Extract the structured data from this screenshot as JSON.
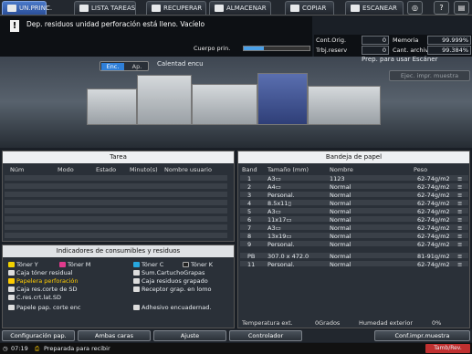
{
  "tabs": [
    "UN.PRINC.",
    "LISTA TAREAS",
    "RECUPERAR",
    "ALMACENAR",
    "COPIAR",
    "ESCANEAR"
  ],
  "message": {
    "text": "Dep. residuos unidad perforación está lleno. Vacíelo",
    "cuerpo_label": "Cuerpo prin.",
    "cuerpo_level": 0.3
  },
  "counters": {
    "cont_orig_label": "Cont.Orig.",
    "cont_orig": "0",
    "memoria_label": "Memoria",
    "memoria": "99.999%",
    "trbj_label": "Trbj.reserv",
    "trbj": "0",
    "cant_label": "Cant. archiv.",
    "cant": "99.384%"
  },
  "mode": {
    "enc": "Enc.",
    "ap": "Ap.",
    "calent": "Calentad encu"
  },
  "scanner": {
    "prep": "Prep. para usar Escáner",
    "ejec": "Ejec. impr. muestra"
  },
  "tarea": {
    "title": "Tarea",
    "headers": [
      "Núm",
      "Modo",
      "Estado",
      "Minuto(s)",
      "Nombre usuario"
    ]
  },
  "bandeja": {
    "title": "Bandeja de papel",
    "headers": [
      "Band",
      "Tamaño (mm)",
      "Nombre",
      "Peso"
    ],
    "rows": [
      {
        "b": "1",
        "t": "A3▭",
        "n": "1123",
        "p": "62-74g/m2"
      },
      {
        "b": "2",
        "t": "A4▭",
        "n": "Normal",
        "p": "62-74g/m2"
      },
      {
        "b": "3",
        "t": "Personal.",
        "n": "Normal",
        "p": "62-74g/m2"
      },
      {
        "b": "4",
        "t": "8.5x11▯",
        "n": "Normal",
        "p": "62-74g/m2"
      },
      {
        "b": "5",
        "t": "A3▭",
        "n": "Normal",
        "p": "62-74g/m2"
      },
      {
        "b": "6",
        "t": "11x17▭",
        "n": "Normal",
        "p": "62-74g/m2"
      },
      {
        "b": "7",
        "t": "A3▭",
        "n": "Normal",
        "p": "62-74g/m2"
      },
      {
        "b": "8",
        "t": "13x19▭",
        "n": "Normal",
        "p": "62-74g/m2"
      },
      {
        "b": "9",
        "t": "Personal.",
        "n": "Normal",
        "p": "62-74g/m2"
      },
      {
        "b": "PB",
        "t": "307.0 x 472.0",
        "n": "Normal",
        "p": "81-91g/m2"
      },
      {
        "b": "11",
        "t": "Personal.",
        "n": "Normal",
        "p": "62-74g/m2"
      }
    ],
    "temp_label": "Temperatura ext.",
    "temp": "0Grados",
    "hum_label": "Humedad exterior",
    "hum": "0%"
  },
  "consumibles": {
    "title": "Indicadores de consumibles y residuos",
    "items": [
      "Tóner Y",
      "Tóner M",
      "Tóner C",
      "Tóner K",
      "Caja tóner residual",
      "Sum.CartuchoGrapas",
      "Papelera perforación",
      "Caja residuos grapado",
      "Caja res.corte de SD",
      "Receptor grap. en lomo",
      "C.res.crt.lat.SD",
      "Papele pap. corte enc",
      "Adhesivo encuadernad."
    ]
  },
  "buttons": [
    "Configuración pap.",
    "Ambas caras",
    "Ajuste",
    "Controlador",
    "Conf.impr.muestra"
  ],
  "status": {
    "time": "07:19",
    "text": "Preparada para recibir",
    "tamb": "Tamb/Rev."
  },
  "colors": {
    "accent": "#3d6ab8",
    "warning": "#ffcc00"
  }
}
